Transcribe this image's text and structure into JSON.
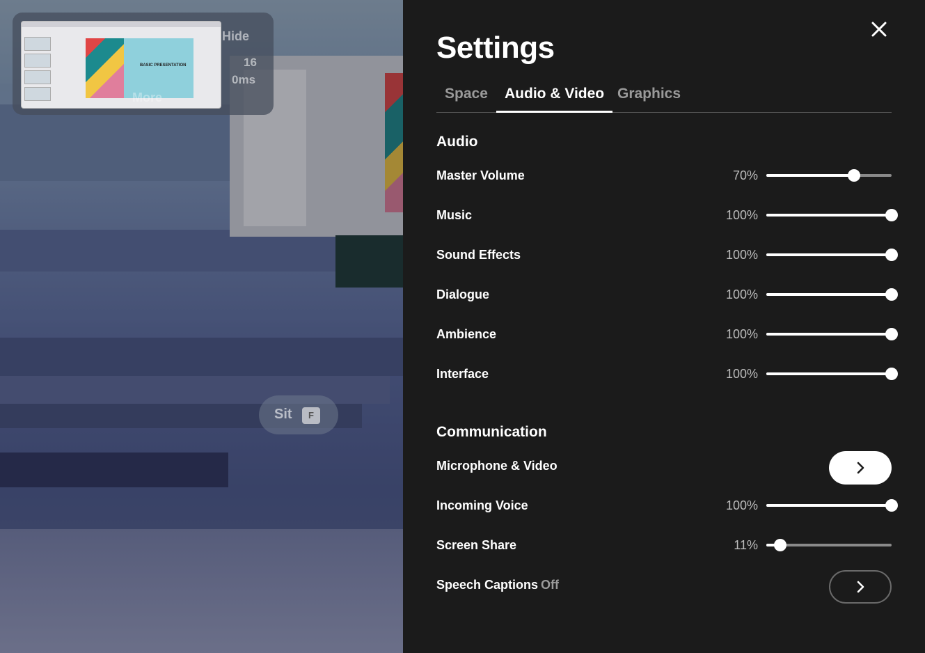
{
  "scene": {
    "hide_label": "Hide",
    "fps": "16",
    "ping": "0ms",
    "more_label": "More",
    "thumbnail_title": "BASIC PRESENTATION",
    "sit_prompt": {
      "label": "Sit",
      "key": "F"
    }
  },
  "settings": {
    "title": "Settings",
    "tabs": [
      {
        "label": "Space",
        "active": false
      },
      {
        "label": "Audio & Video",
        "active": true
      },
      {
        "label": "Graphics",
        "active": false
      }
    ],
    "audio": {
      "title": "Audio",
      "rows": [
        {
          "label": "Master Volume",
          "value_text": "70%",
          "value": 0.7
        },
        {
          "label": "Music",
          "value_text": "100%",
          "value": 1.0
        },
        {
          "label": "Sound Effects",
          "value_text": "100%",
          "value": 1.0
        },
        {
          "label": "Dialogue",
          "value_text": "100%",
          "value": 1.0
        },
        {
          "label": "Ambience",
          "value_text": "100%",
          "value": 1.0
        },
        {
          "label": "Interface",
          "value_text": "100%",
          "value": 1.0
        }
      ]
    },
    "communication": {
      "title": "Communication",
      "microphone_video": {
        "label": "Microphone & Video"
      },
      "incoming_voice": {
        "label": "Incoming Voice",
        "value_text": "100%",
        "value": 1.0
      },
      "screen_share": {
        "label": "Screen Share",
        "value_text": "11%",
        "value": 0.11
      },
      "speech_captions": {
        "label": "Speech Captions",
        "status": "Off"
      }
    }
  },
  "icons": {
    "close": "close-icon",
    "chevron": "chevron-right-icon"
  },
  "colors": {
    "panel_bg": "#1b1b1b",
    "accent": "#ffffff",
    "muted_text": "#9a9a9a",
    "slider_track": "#8a8a8a"
  }
}
